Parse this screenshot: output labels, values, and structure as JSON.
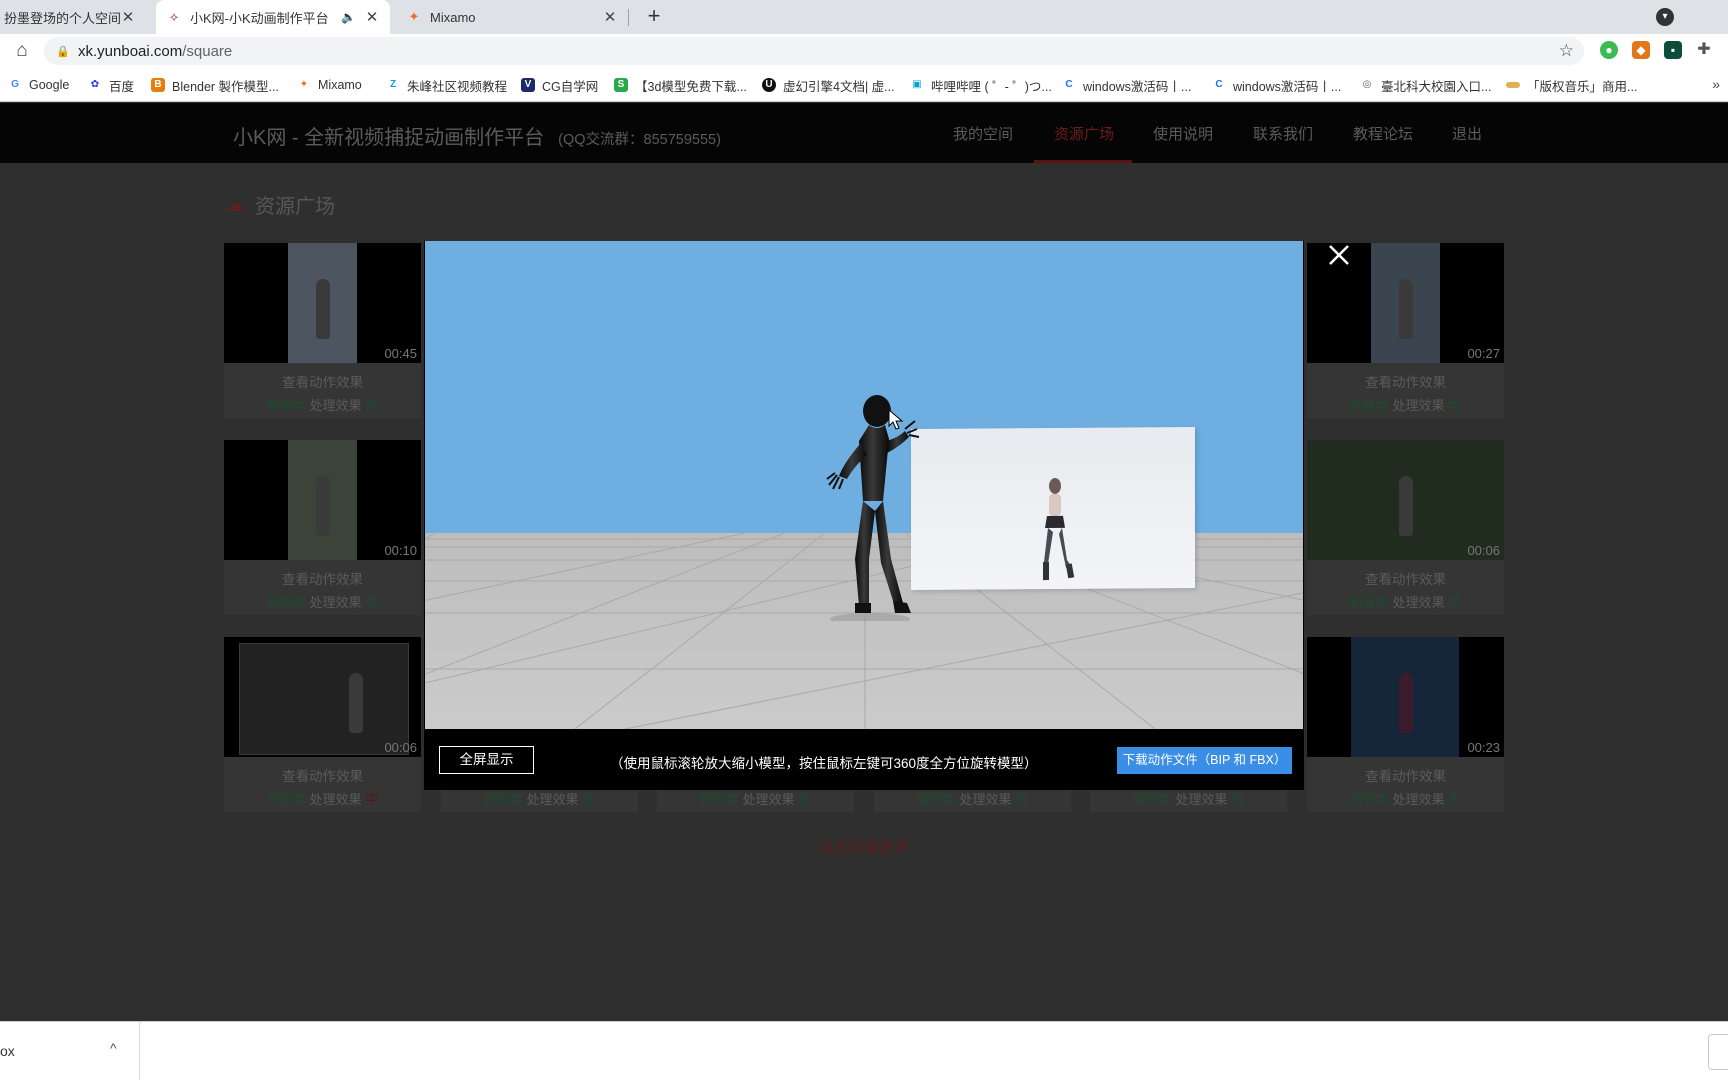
{
  "browser": {
    "tabs": [
      {
        "title": "扮墨登场的个人空间_哔",
        "icon": "sound-wave"
      },
      {
        "title": "小K网-小K动画制作平台",
        "icon": "yunboai-logo",
        "audio": "🔈"
      },
      {
        "title": "Mixamo",
        "icon": "mixamo-logo"
      }
    ],
    "tab_close": "✕",
    "new_tab": "+",
    "tab_menu": "▾",
    "url_host": "xk.yunboai.com",
    "url_path": "/square",
    "bookmarks": [
      {
        "label": "Google",
        "icon": "G",
        "color": "#4285f4"
      },
      {
        "label": "百度",
        "icon": "🐾",
        "color": "#2932e1"
      },
      {
        "label": "Blender 製作模型...",
        "icon": "B",
        "color": "#e87d0d"
      },
      {
        "label": "Mixamo",
        "icon": "✦",
        "color": "#f26b21"
      },
      {
        "label": "朱峰社区视频教程",
        "icon": "Z",
        "color": "#1a9bd7"
      },
      {
        "label": "CG自学网",
        "icon": "V",
        "color": "#1b2a6b"
      },
      {
        "label": "【3d模型免费下载...",
        "icon": "S",
        "color": "#2aa84a"
      },
      {
        "label": "虚幻引擎4文档| 虚...",
        "icon": "U",
        "color": "#111111"
      },
      {
        "label": "哔哩哔哩 ( ゜- ゜)つ...",
        "icon": "▣",
        "color": "#00a1d6"
      },
      {
        "label": "windows激活码丨...",
        "icon": "C",
        "color": "#1a73e8"
      },
      {
        "label": "windows激活码丨...",
        "icon": "C",
        "color": "#1a73e8"
      },
      {
        "label": "臺北科大校園入口...",
        "icon": "◎",
        "color": "#555555"
      },
      {
        "label": "「版权音乐」商用...",
        "icon": "▬",
        "color": "#e0b050"
      }
    ],
    "bookmarks_more": "»"
  },
  "site": {
    "logo": "小K网 - 全新视频捕捉动画制作平台",
    "qq": "(QQ交流群：855759555)",
    "nav": [
      "我的空间",
      "资源广场",
      "使用说明",
      "联系我们",
      "教程论坛",
      "退出"
    ],
    "section_title": "资源广场",
    "load_more": "点击加载更多"
  },
  "cards": [
    {
      "duration": "00:45",
      "view": "查看动作效果",
      "version": "新版本",
      "effect": "处理效果",
      "grade": "优",
      "frame_color": "#4c5560"
    },
    {
      "duration": "00:27",
      "view": "查看动作效果",
      "version": "新版本",
      "effect": "处理效果",
      "grade": "优",
      "frame_color": "#3a4550"
    },
    {
      "duration": "00:10",
      "view": "查看动作效果",
      "version": "新版本",
      "effect": "处理效果",
      "grade": "优",
      "frame_color": "#3c4338"
    },
    {
      "duration": "00:06",
      "view": "查看动作效果",
      "version": "新版本",
      "effect": "处理效果",
      "grade": "优",
      "frame_color": "#1f2c1e"
    },
    {
      "duration": "00:06",
      "view": "查看动作效果",
      "version": "新版本",
      "effect": "处理效果",
      "grade": "中",
      "frame_color": "#222222"
    },
    {
      "duration": "00:23",
      "view": "查看动作效果",
      "version": "新版本",
      "effect": "处理效果",
      "grade": "优",
      "frame_color": "#15253a"
    }
  ],
  "hidden_card_status": {
    "version": "新版本",
    "effect": "处理效果",
    "grade": "优"
  },
  "modal": {
    "fullscreen": "全屏显示",
    "hint": "（使用鼠标滚轮放大缩小模型，按住鼠标左键可360度全方位旋转模型）",
    "download": "下载动作文件（BIP 和 FBX）",
    "close_icon": "close-icon"
  },
  "download_shelf": {
    "file": "ox",
    "chevron": "^"
  }
}
